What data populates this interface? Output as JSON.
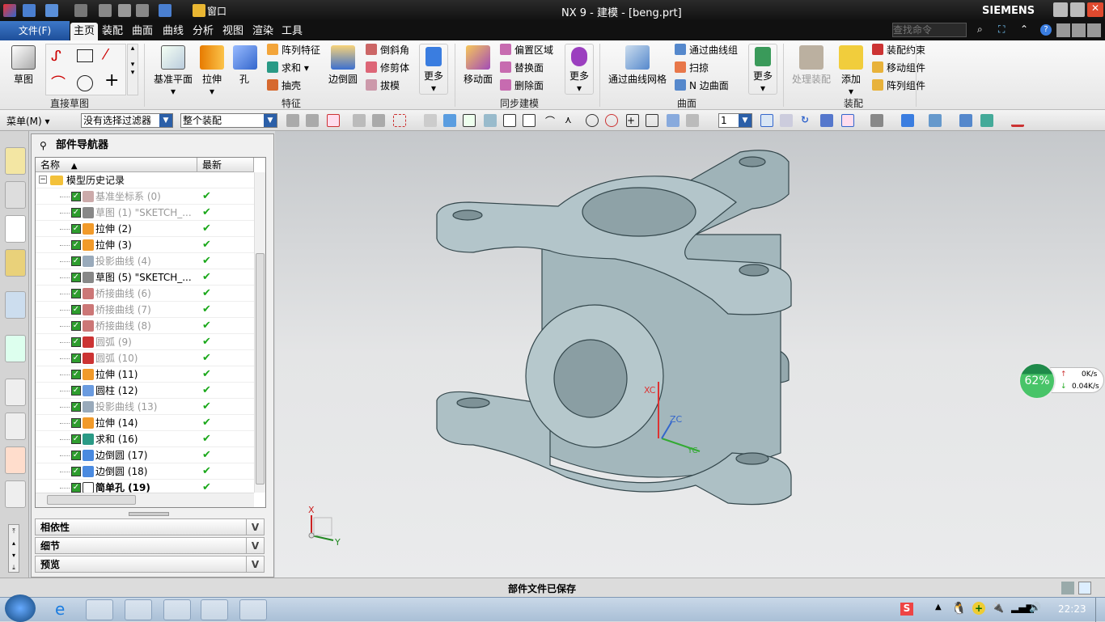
{
  "window": {
    "title": "NX 9 - 建模 - [beng.prt]",
    "brand": "SIEMENS",
    "quick_window_menu": "窗口"
  },
  "menu_tabs": {
    "file": "文件(F)",
    "tabs": [
      "主页",
      "装配",
      "曲面",
      "曲线",
      "分析",
      "视图",
      "渲染",
      "工具"
    ],
    "active": "主页"
  },
  "search": {
    "placeholder": "查找命令"
  },
  "ribbon": {
    "sketch": "草图",
    "direct_sketch_group": "直接草图",
    "feature": {
      "datum_plane": "基准平面",
      "extrude": "拉伸",
      "hole": "孔",
      "pattern": "阵列特征",
      "unite": "求和",
      "shell": "抽壳",
      "edge_blend": "边倒圆",
      "chamfer": "倒斜角",
      "trim_body": "修剪体",
      "draft": "拔模",
      "more": "更多",
      "group": "特征"
    },
    "sync": {
      "move_face": "移动面",
      "offset_region": "偏置区域",
      "replace_face": "替换面",
      "delete_face": "删除面",
      "more": "更多",
      "group": "同步建模"
    },
    "surface": {
      "through_curve_mesh": "通过曲线网格",
      "through_curves": "通过曲线组",
      "swept": "扫掠",
      "n_sided": "N 边曲面",
      "more": "更多",
      "group": "曲面"
    },
    "assembly": {
      "process": "处理装配",
      "add": "添加",
      "constraint": "装配约束",
      "move_component": "移动组件",
      "pattern_component": "阵列组件",
      "group": "装配"
    }
  },
  "toolbar": {
    "menu": "菜单(M)",
    "filter": "没有选择过滤器",
    "scope": "整个装配",
    "layer": "1"
  },
  "navigator": {
    "title": "部件导航器",
    "col_name": "名称",
    "col_latest": "最新",
    "root": "模型历史记录",
    "items": [
      {
        "label": "基准坐标系 (0)",
        "dim": true,
        "icon": "datum-csys"
      },
      {
        "label": "草图 (1) \"SKETCH_...",
        "dim": true,
        "icon": "sketch"
      },
      {
        "label": "拉伸 (2)",
        "dim": false,
        "icon": "extrude"
      },
      {
        "label": "拉伸 (3)",
        "dim": false,
        "icon": "extrude"
      },
      {
        "label": "投影曲线 (4)",
        "dim": true,
        "icon": "project-curve"
      },
      {
        "label": "草图 (5) \"SKETCH_...",
        "dim": false,
        "icon": "sketch"
      },
      {
        "label": "桥接曲线 (6)",
        "dim": true,
        "icon": "bridge-curve"
      },
      {
        "label": "桥接曲线 (7)",
        "dim": true,
        "icon": "bridge-curve"
      },
      {
        "label": "桥接曲线 (8)",
        "dim": true,
        "icon": "bridge-curve"
      },
      {
        "label": "圆弧 (9)",
        "dim": true,
        "icon": "arc"
      },
      {
        "label": "圆弧 (10)",
        "dim": true,
        "icon": "arc"
      },
      {
        "label": "拉伸 (11)",
        "dim": false,
        "icon": "extrude"
      },
      {
        "label": "圆柱 (12)",
        "dim": false,
        "icon": "cylinder"
      },
      {
        "label": "投影曲线 (13)",
        "dim": true,
        "icon": "project-curve"
      },
      {
        "label": "拉伸 (14)",
        "dim": false,
        "icon": "extrude"
      },
      {
        "label": "求和 (16)",
        "dim": false,
        "icon": "unite"
      },
      {
        "label": "边倒圆 (17)",
        "dim": false,
        "icon": "edge-blend"
      },
      {
        "label": "边倒圆 (18)",
        "dim": false,
        "icon": "edge-blend"
      },
      {
        "label": "简单孔 (19)",
        "dim": false,
        "bold": true,
        "icon": "hole"
      }
    ],
    "panels": [
      "相依性",
      "细节",
      "预览"
    ]
  },
  "viewport": {
    "axis_x": "X",
    "axis_y": "Y",
    "wcs_xc": "XC",
    "wcs_zc": "ZC",
    "wcs_yc": "YC"
  },
  "net_widget": {
    "percent": "62%",
    "upload": "0K/s",
    "download": "0.04K/s"
  },
  "status": {
    "message": "部件文件已保存"
  },
  "taskbar": {
    "clock": "22:23"
  },
  "colors": {
    "model": "#a8bcc1",
    "accent": "#2b5fa8",
    "check": "#1aa81a"
  }
}
